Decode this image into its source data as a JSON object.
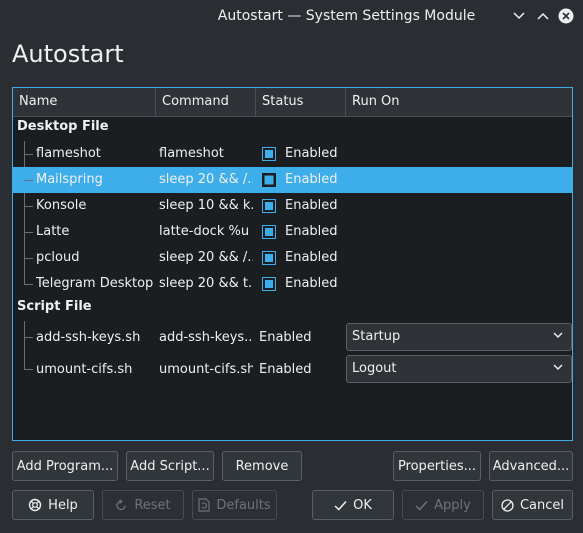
{
  "window": {
    "title": "Autostart — System Settings Module"
  },
  "page": {
    "title": "Autostart"
  },
  "table": {
    "columns": [
      "Name",
      "Command",
      "Status",
      "Run On"
    ],
    "groups": [
      {
        "label": "Desktop File",
        "rows": [
          {
            "name": "flameshot",
            "command": "flameshot",
            "checked": true,
            "status": "Enabled"
          },
          {
            "name": "Mailspring",
            "command": "sleep 20 && /...",
            "checked": false,
            "status": "Enabled"
          },
          {
            "name": "Konsole",
            "command": "sleep 10 && k...",
            "checked": true,
            "status": "Enabled"
          },
          {
            "name": "Latte",
            "command": "latte-dock %u",
            "checked": true,
            "status": "Enabled"
          },
          {
            "name": "pcloud",
            "command": "sleep 20 && /...",
            "checked": true,
            "status": "Enabled"
          },
          {
            "name": "Telegram Desktop",
            "command": "sleep 20 && t...",
            "checked": true,
            "status": "Enabled"
          }
        ]
      },
      {
        "label": "Script File",
        "rows": [
          {
            "name": "add-ssh-keys.sh",
            "command": "add-ssh-keys....",
            "status": "Enabled",
            "run_on": "Startup"
          },
          {
            "name": "umount-cifs.sh",
            "command": "umount-cifs.sh",
            "status": "Enabled",
            "run_on": "Logout"
          }
        ]
      }
    ]
  },
  "actions": {
    "add_program": "Add Program...",
    "add_script": "Add Script...",
    "remove": "Remove",
    "properties": "Properties...",
    "advanced": "Advanced..."
  },
  "footer": {
    "help": "Help",
    "reset": "Reset",
    "defaults": "Defaults",
    "ok": "OK",
    "apply": "Apply",
    "cancel": "Cancel"
  },
  "colors": {
    "accent": "#3daee9",
    "window_bg": "#2a2e32",
    "view_bg": "#1b1e20"
  }
}
